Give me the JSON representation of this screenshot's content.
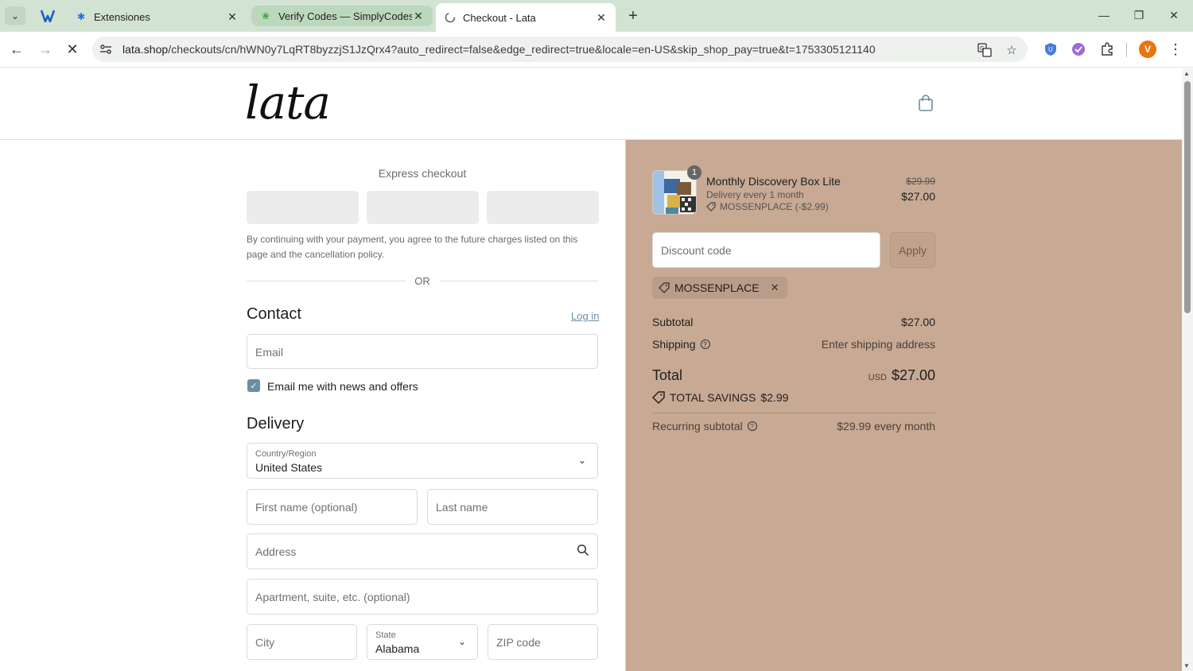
{
  "browser": {
    "tabs": [
      {
        "title": "Extensiones"
      },
      {
        "title": "Verify Codes — SimplyCodes"
      },
      {
        "title": "Checkout - Lata"
      }
    ],
    "url_domain": "lata.shop",
    "url_path": "/checkouts/cn/hWN0y7LqRT8byzzjS1JzQrx4?auto_redirect=false&edge_redirect=true&locale=en-US&skip_shop_pay=true&t=1753305121140",
    "profile_initial": "V"
  },
  "header": {
    "logo_text": "lata"
  },
  "express": {
    "title": "Express checkout",
    "consent": "By continuing with your payment, you agree to the future charges listed on this page and the cancellation policy.",
    "or": "OR"
  },
  "contact": {
    "title": "Contact",
    "login": "Log in",
    "email_placeholder": "Email",
    "newsletter_label": "Email me with news and offers"
  },
  "delivery": {
    "title": "Delivery",
    "country_label": "Country/Region",
    "country_value": "United States",
    "first_name_placeholder": "First name (optional)",
    "last_name_placeholder": "Last name",
    "address_placeholder": "Address",
    "apartment_placeholder": "Apartment, suite, etc. (optional)",
    "city_placeholder": "City",
    "state_label": "State",
    "state_value": "Alabama",
    "zip_placeholder": "ZIP code"
  },
  "summary": {
    "product": {
      "quantity": "1",
      "name": "Monthly Discovery Box Lite",
      "delivery": "Delivery every 1 month",
      "discount": "MOSSENPLACE (-$2.99)",
      "old_price": "$29.99",
      "price": "$27.00"
    },
    "discount_placeholder": "Discount code",
    "apply_label": "Apply",
    "applied_code": "MOSSENPLACE",
    "subtotal_label": "Subtotal",
    "subtotal_value": "$27.00",
    "shipping_label": "Shipping",
    "shipping_value": "Enter shipping address",
    "total_label": "Total",
    "total_currency": "USD",
    "total_value": "$27.00",
    "savings_label": "TOTAL SAVINGS",
    "savings_value": "$2.99",
    "recurring_label": "Recurring subtotal",
    "recurring_value": "$29.99 every month"
  },
  "colors": {
    "summary_bg": "#c7a994",
    "accent": "#6a8ea3"
  }
}
